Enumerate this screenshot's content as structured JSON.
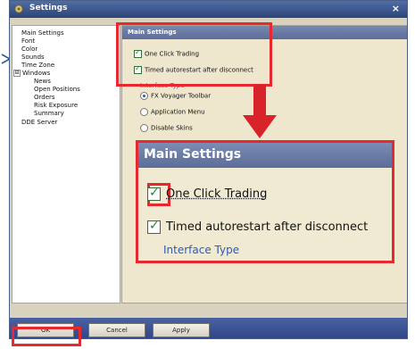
{
  "window": {
    "title": "Settings",
    "close_glyph": "×"
  },
  "tree": {
    "items": [
      {
        "label": "Main Settings"
      },
      {
        "label": "Font"
      },
      {
        "label": "Color"
      },
      {
        "label": "Sounds"
      },
      {
        "label": "Time Zone"
      },
      {
        "label": "Windows",
        "expander": "⊟"
      },
      {
        "label": "News"
      },
      {
        "label": "Open Positions"
      },
      {
        "label": "Orders"
      },
      {
        "label": "Risk Exposure"
      },
      {
        "label": "Summary"
      },
      {
        "label": "DDE Server"
      }
    ]
  },
  "panel": {
    "header": "Main Settings",
    "checks": [
      {
        "label": "One Click Trading",
        "checked": true
      },
      {
        "label": "Timed autorestart after disconnect",
        "checked": true
      }
    ],
    "interface_type_label": "Interface Type",
    "radios": [
      {
        "label": "FX Voyager Toolbar",
        "selected": true
      },
      {
        "label": "Application Menu",
        "selected": false
      },
      {
        "label": "Disable Skins",
        "selected": false
      }
    ]
  },
  "zoom": {
    "header": "Main Settings",
    "checks": [
      {
        "label": "One Click Trading"
      },
      {
        "label": "Timed autorestart after disconnect"
      }
    ],
    "group_label": "Interface Type"
  },
  "buttons": {
    "ok": "OK",
    "cancel": "Cancel",
    "apply": "Apply"
  },
  "colors": {
    "highlight": "#e8282e",
    "titlebar": "#2b4478",
    "link": "#2d5ab5"
  }
}
